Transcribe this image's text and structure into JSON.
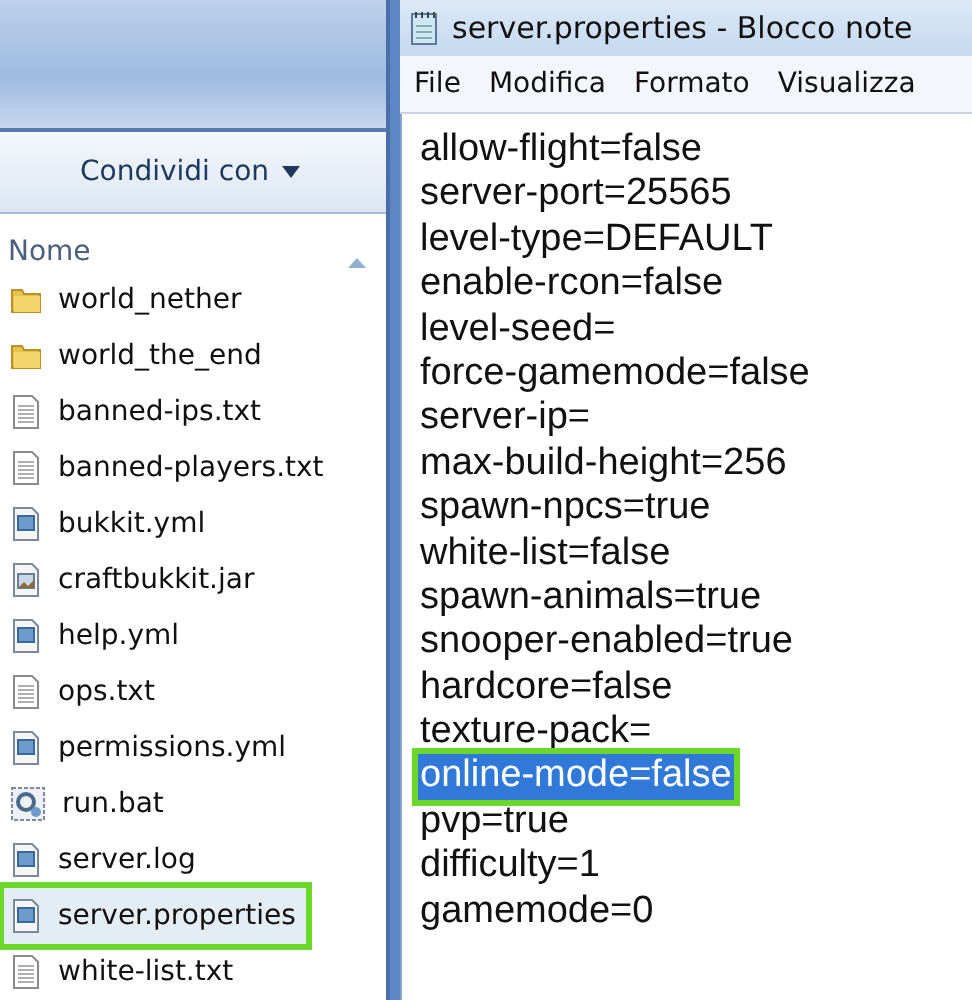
{
  "explorer": {
    "share_button": "Condividi con",
    "column_header": "Nome",
    "files": [
      {
        "name": "world_nether",
        "kind": "folder",
        "selected": false,
        "highlighted": false
      },
      {
        "name": "world_the_end",
        "kind": "folder",
        "selected": false,
        "highlighted": false
      },
      {
        "name": "banned-ips.txt",
        "kind": "text",
        "selected": false,
        "highlighted": false
      },
      {
        "name": "banned-players.txt",
        "kind": "text",
        "selected": false,
        "highlighted": false
      },
      {
        "name": "bukkit.yml",
        "kind": "config",
        "selected": false,
        "highlighted": false
      },
      {
        "name": "craftbukkit.jar",
        "kind": "archive",
        "selected": false,
        "highlighted": false
      },
      {
        "name": "help.yml",
        "kind": "config",
        "selected": false,
        "highlighted": false
      },
      {
        "name": "ops.txt",
        "kind": "text",
        "selected": false,
        "highlighted": false
      },
      {
        "name": "permissions.yml",
        "kind": "config",
        "selected": false,
        "highlighted": false
      },
      {
        "name": "run.bat",
        "kind": "batch",
        "selected": false,
        "highlighted": false
      },
      {
        "name": "server.log",
        "kind": "config",
        "selected": false,
        "highlighted": false
      },
      {
        "name": "server.properties",
        "kind": "config",
        "selected": true,
        "highlighted": true
      },
      {
        "name": "white-list.txt",
        "kind": "text",
        "selected": false,
        "highlighted": false
      }
    ]
  },
  "notepad": {
    "title": "server.properties - Blocco note",
    "menu": [
      "File",
      "Modifica",
      "Formato",
      "Visualizza"
    ],
    "lines": [
      {
        "text": "allow-flight=false",
        "selected": false,
        "highlighted": false
      },
      {
        "text": "server-port=25565",
        "selected": false,
        "highlighted": false
      },
      {
        "text": "level-type=DEFAULT",
        "selected": false,
        "highlighted": false
      },
      {
        "text": "enable-rcon=false",
        "selected": false,
        "highlighted": false
      },
      {
        "text": "level-seed=",
        "selected": false,
        "highlighted": false
      },
      {
        "text": "force-gamemode=false",
        "selected": false,
        "highlighted": false
      },
      {
        "text": "server-ip=",
        "selected": false,
        "highlighted": false
      },
      {
        "text": "max-build-height=256",
        "selected": false,
        "highlighted": false
      },
      {
        "text": "spawn-npcs=true",
        "selected": false,
        "highlighted": false
      },
      {
        "text": "white-list=false",
        "selected": false,
        "highlighted": false
      },
      {
        "text": "spawn-animals=true",
        "selected": false,
        "highlighted": false
      },
      {
        "text": "snooper-enabled=true",
        "selected": false,
        "highlighted": false
      },
      {
        "text": "hardcore=false",
        "selected": false,
        "highlighted": false
      },
      {
        "text": "texture-pack=",
        "selected": false,
        "highlighted": false
      },
      {
        "text": "online-mode=false",
        "selected": true,
        "highlighted": true
      },
      {
        "text": "pvp=true",
        "selected": false,
        "highlighted": false
      },
      {
        "text": "difficulty=1",
        "selected": false,
        "highlighted": false
      },
      {
        "text": "gamemode=0",
        "selected": false,
        "highlighted": false
      }
    ]
  }
}
